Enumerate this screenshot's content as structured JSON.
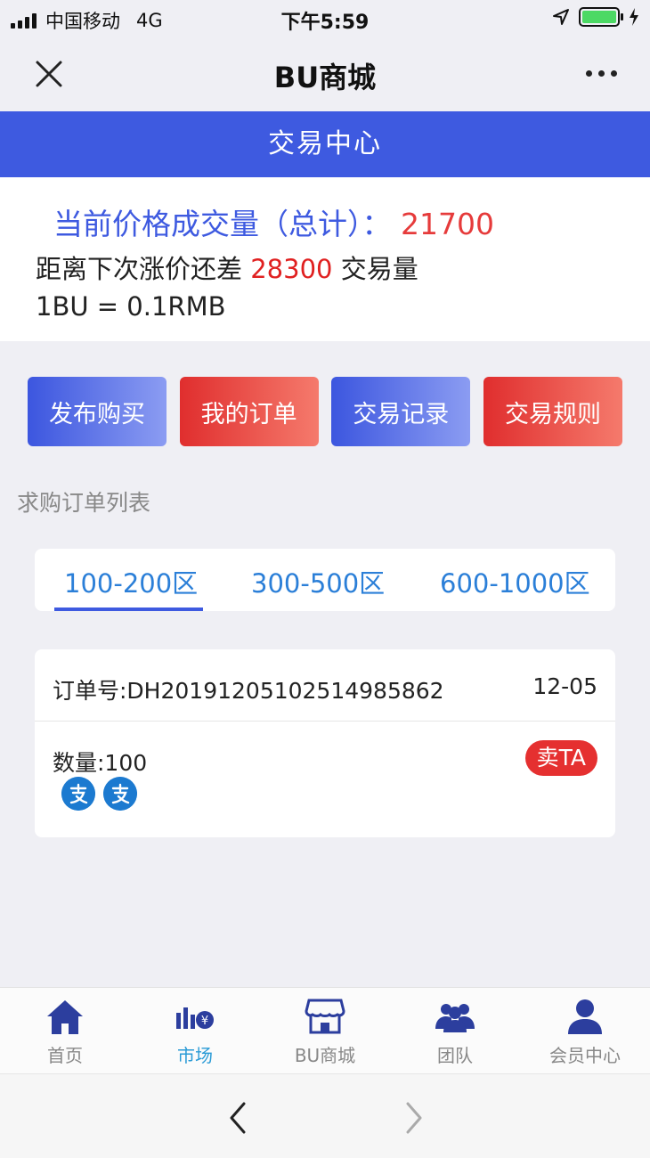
{
  "status_bar": {
    "carrier": "中国移动",
    "network": "4G",
    "time": "下午5:59"
  },
  "nav": {
    "title": "BU商城"
  },
  "banner": {
    "title": "交易中心"
  },
  "info": {
    "line1_label": "当前价格成交量（总计）：",
    "line1_value": "21700",
    "line2_prefix": "距离下次涨价还差",
    "line2_value": "28300",
    "line2_suffix": "交易量",
    "rate": "1BU =  0.1RMB"
  },
  "actions": [
    {
      "label": "发布购买",
      "color": "blue"
    },
    {
      "label": "我的订单",
      "color": "red"
    },
    {
      "label": "交易记录",
      "color": "blue"
    },
    {
      "label": "交易规则",
      "color": "red"
    }
  ],
  "section_title": "求购订单列表",
  "tabs": [
    {
      "label": "100-200区",
      "active": true
    },
    {
      "label": "300-500区",
      "active": false
    },
    {
      "label": "600-1000区",
      "active": false
    }
  ],
  "order": {
    "order_no": "订单号:DH20191205102514985862",
    "date": "12-05",
    "quantity": "数量:100",
    "sell_label": "卖TA",
    "payment_icons": [
      "alipay-icon",
      "alipay-icon"
    ]
  },
  "tabbar": [
    {
      "label": "首页",
      "icon": "home-icon",
      "active": false
    },
    {
      "label": "市场",
      "icon": "market-chart-icon",
      "active": true
    },
    {
      "label": "BU商城",
      "icon": "shop-icon",
      "active": false
    },
    {
      "label": "团队",
      "icon": "team-icon",
      "active": false
    },
    {
      "label": "会员中心",
      "icon": "user-icon",
      "active": false
    }
  ],
  "colors": {
    "primary_blue": "#3e5ae0",
    "accent_red": "#e53030",
    "tab_active": "#2a9bd6",
    "background": "#efeff4"
  }
}
